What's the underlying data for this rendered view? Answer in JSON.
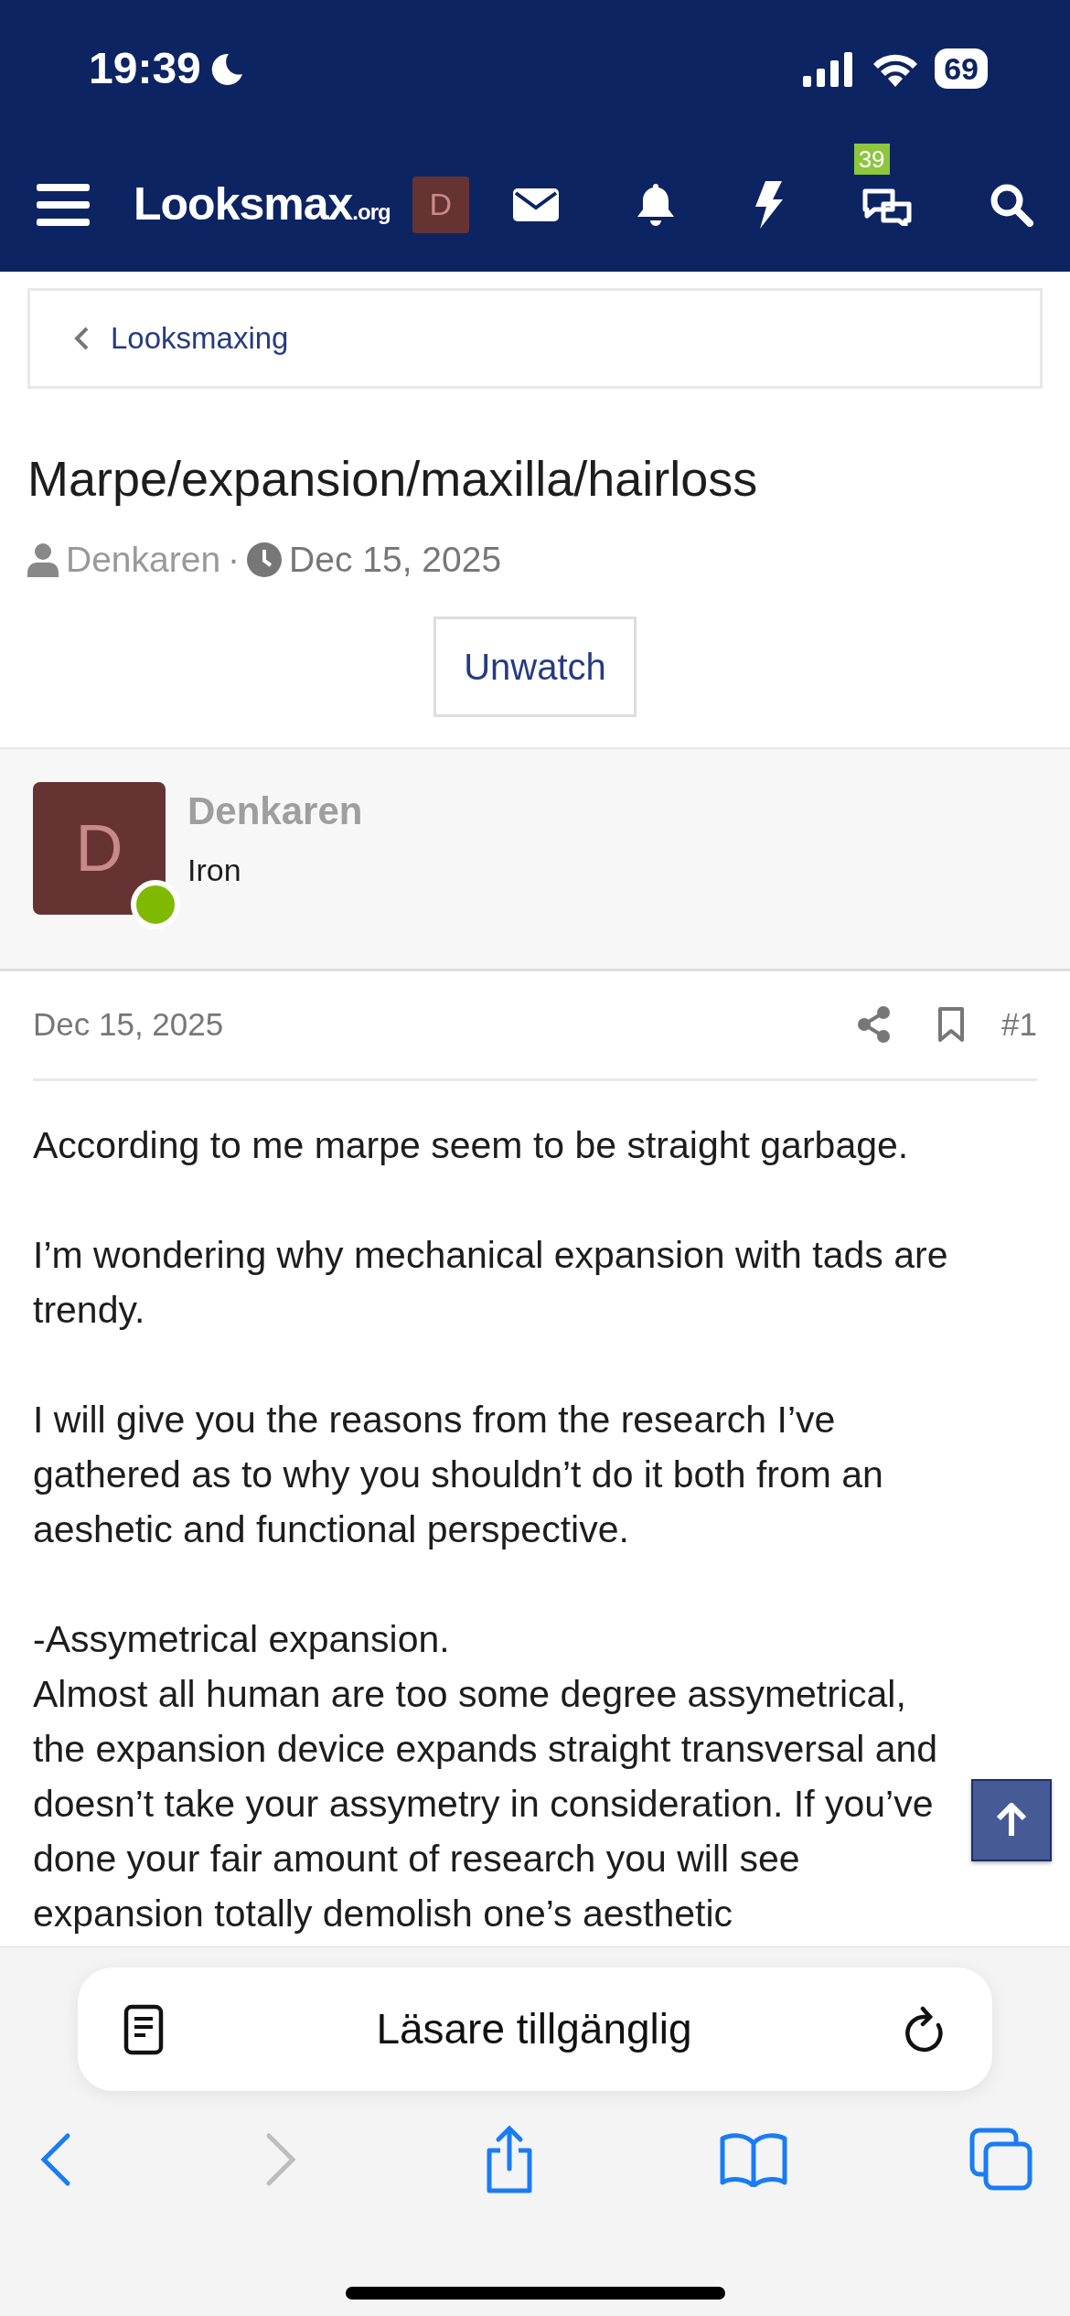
{
  "status_bar": {
    "time": "19:39",
    "battery": "69"
  },
  "navbar": {
    "logo": "Looksmax",
    "logo_suffix": ".org",
    "avatar_letter": "D",
    "conversations_badge": "39"
  },
  "breadcrumb": {
    "label": "Looksmaxing"
  },
  "thread": {
    "title": "Marpe/expansion/maxilla/hairloss",
    "author": "Denkaren",
    "separator": "·",
    "date": "Dec 15, 2025",
    "watch_button": "Unwatch"
  },
  "post": {
    "author": "Denkaren",
    "avatar_letter": "D",
    "online": true,
    "user_title": "Iron",
    "date": "Dec 15, 2025",
    "number": "#1",
    "paragraphs": [
      [
        "According to me marpe seem to be straight garbage."
      ],
      [
        "I’m wondering why mechanical expansion with tads are trendy."
      ],
      [
        "I will give you the reasons from the research I’ve gathered as to why you shouldn’t do it both from an aeshetic and functional perspective."
      ],
      [
        "-Assymetrical expansion.",
        "Almost all human are too some degree assymetrical, the expansion device expands straight transversal and doesn’t take your assymetry in consideration. If you’ve done your fair amount of research you will see expansion totally demolish one’s aesthetic"
      ]
    ]
  },
  "browser": {
    "reader_label": "Läsare tillgänglig",
    "back_disabled": false,
    "forward_disabled": true
  }
}
